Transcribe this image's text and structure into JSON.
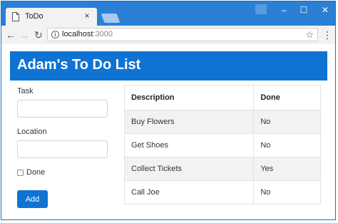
{
  "browser": {
    "tab_title": "ToDo",
    "tab_close": "×",
    "url_host": "localhost",
    "url_port": ":3000",
    "window_controls": {
      "minimize": "–",
      "maximize": "☐",
      "close": "✕"
    }
  },
  "app": {
    "title": "Adam's To Do List",
    "form": {
      "task_label": "Task",
      "task_value": "",
      "location_label": "Location",
      "location_value": "",
      "done_label": "Done",
      "done_checked": false,
      "add_label": "Add"
    },
    "table": {
      "headers": [
        "Description",
        "Done"
      ],
      "rows": [
        {
          "description": "Buy Flowers",
          "done": "No"
        },
        {
          "description": "Get Shoes",
          "done": "No"
        },
        {
          "description": "Collect Tickets",
          "done": "Yes"
        },
        {
          "description": "Call Joe",
          "done": "No"
        }
      ]
    }
  },
  "colors": {
    "accent": "#0f73d3",
    "chrome_titlebar": "#2b80d6",
    "striped_row": "#f2f2f2"
  },
  "icons": [
    "page-icon",
    "back-arrow-icon",
    "forward-arrow-icon",
    "reload-icon",
    "info-icon",
    "star-icon",
    "menu-icon",
    "user-icon"
  ]
}
